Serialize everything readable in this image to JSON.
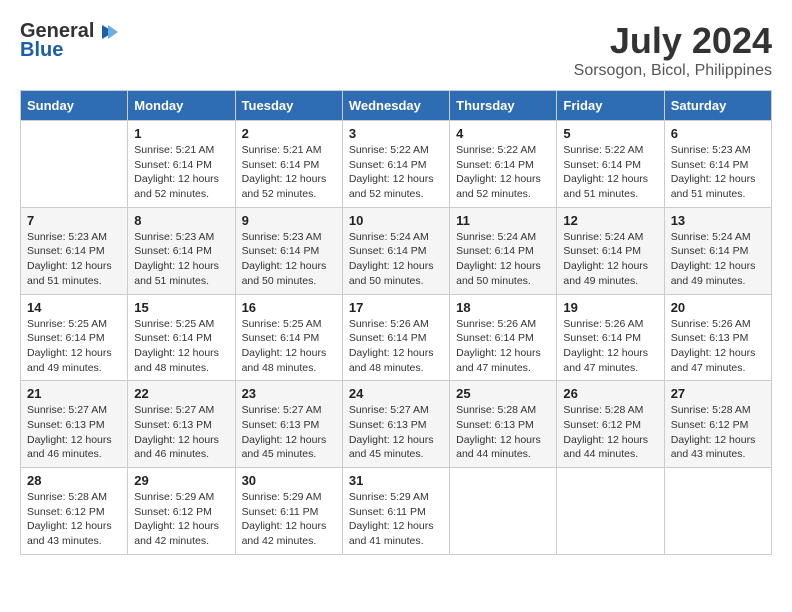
{
  "logo": {
    "general": "General",
    "blue": "Blue"
  },
  "title": "July 2024",
  "location": "Sorsogon, Bicol, Philippines",
  "headers": [
    "Sunday",
    "Monday",
    "Tuesday",
    "Wednesday",
    "Thursday",
    "Friday",
    "Saturday"
  ],
  "weeks": [
    [
      {
        "day": "",
        "info": ""
      },
      {
        "day": "1",
        "info": "Sunrise: 5:21 AM\nSunset: 6:14 PM\nDaylight: 12 hours\nand 52 minutes."
      },
      {
        "day": "2",
        "info": "Sunrise: 5:21 AM\nSunset: 6:14 PM\nDaylight: 12 hours\nand 52 minutes."
      },
      {
        "day": "3",
        "info": "Sunrise: 5:22 AM\nSunset: 6:14 PM\nDaylight: 12 hours\nand 52 minutes."
      },
      {
        "day": "4",
        "info": "Sunrise: 5:22 AM\nSunset: 6:14 PM\nDaylight: 12 hours\nand 52 minutes."
      },
      {
        "day": "5",
        "info": "Sunrise: 5:22 AM\nSunset: 6:14 PM\nDaylight: 12 hours\nand 51 minutes."
      },
      {
        "day": "6",
        "info": "Sunrise: 5:23 AM\nSunset: 6:14 PM\nDaylight: 12 hours\nand 51 minutes."
      }
    ],
    [
      {
        "day": "7",
        "info": "Sunrise: 5:23 AM\nSunset: 6:14 PM\nDaylight: 12 hours\nand 51 minutes."
      },
      {
        "day": "8",
        "info": "Sunrise: 5:23 AM\nSunset: 6:14 PM\nDaylight: 12 hours\nand 51 minutes."
      },
      {
        "day": "9",
        "info": "Sunrise: 5:23 AM\nSunset: 6:14 PM\nDaylight: 12 hours\nand 50 minutes."
      },
      {
        "day": "10",
        "info": "Sunrise: 5:24 AM\nSunset: 6:14 PM\nDaylight: 12 hours\nand 50 minutes."
      },
      {
        "day": "11",
        "info": "Sunrise: 5:24 AM\nSunset: 6:14 PM\nDaylight: 12 hours\nand 50 minutes."
      },
      {
        "day": "12",
        "info": "Sunrise: 5:24 AM\nSunset: 6:14 PM\nDaylight: 12 hours\nand 49 minutes."
      },
      {
        "day": "13",
        "info": "Sunrise: 5:24 AM\nSunset: 6:14 PM\nDaylight: 12 hours\nand 49 minutes."
      }
    ],
    [
      {
        "day": "14",
        "info": "Sunrise: 5:25 AM\nSunset: 6:14 PM\nDaylight: 12 hours\nand 49 minutes."
      },
      {
        "day": "15",
        "info": "Sunrise: 5:25 AM\nSunset: 6:14 PM\nDaylight: 12 hours\nand 48 minutes."
      },
      {
        "day": "16",
        "info": "Sunrise: 5:25 AM\nSunset: 6:14 PM\nDaylight: 12 hours\nand 48 minutes."
      },
      {
        "day": "17",
        "info": "Sunrise: 5:26 AM\nSunset: 6:14 PM\nDaylight: 12 hours\nand 48 minutes."
      },
      {
        "day": "18",
        "info": "Sunrise: 5:26 AM\nSunset: 6:14 PM\nDaylight: 12 hours\nand 47 minutes."
      },
      {
        "day": "19",
        "info": "Sunrise: 5:26 AM\nSunset: 6:14 PM\nDaylight: 12 hours\nand 47 minutes."
      },
      {
        "day": "20",
        "info": "Sunrise: 5:26 AM\nSunset: 6:13 PM\nDaylight: 12 hours\nand 47 minutes."
      }
    ],
    [
      {
        "day": "21",
        "info": "Sunrise: 5:27 AM\nSunset: 6:13 PM\nDaylight: 12 hours\nand 46 minutes."
      },
      {
        "day": "22",
        "info": "Sunrise: 5:27 AM\nSunset: 6:13 PM\nDaylight: 12 hours\nand 46 minutes."
      },
      {
        "day": "23",
        "info": "Sunrise: 5:27 AM\nSunset: 6:13 PM\nDaylight: 12 hours\nand 45 minutes."
      },
      {
        "day": "24",
        "info": "Sunrise: 5:27 AM\nSunset: 6:13 PM\nDaylight: 12 hours\nand 45 minutes."
      },
      {
        "day": "25",
        "info": "Sunrise: 5:28 AM\nSunset: 6:13 PM\nDaylight: 12 hours\nand 44 minutes."
      },
      {
        "day": "26",
        "info": "Sunrise: 5:28 AM\nSunset: 6:12 PM\nDaylight: 12 hours\nand 44 minutes."
      },
      {
        "day": "27",
        "info": "Sunrise: 5:28 AM\nSunset: 6:12 PM\nDaylight: 12 hours\nand 43 minutes."
      }
    ],
    [
      {
        "day": "28",
        "info": "Sunrise: 5:28 AM\nSunset: 6:12 PM\nDaylight: 12 hours\nand 43 minutes."
      },
      {
        "day": "29",
        "info": "Sunrise: 5:29 AM\nSunset: 6:12 PM\nDaylight: 12 hours\nand 42 minutes."
      },
      {
        "day": "30",
        "info": "Sunrise: 5:29 AM\nSunset: 6:11 PM\nDaylight: 12 hours\nand 42 minutes."
      },
      {
        "day": "31",
        "info": "Sunrise: 5:29 AM\nSunset: 6:11 PM\nDaylight: 12 hours\nand 41 minutes."
      },
      {
        "day": "",
        "info": ""
      },
      {
        "day": "",
        "info": ""
      },
      {
        "day": "",
        "info": ""
      }
    ]
  ]
}
